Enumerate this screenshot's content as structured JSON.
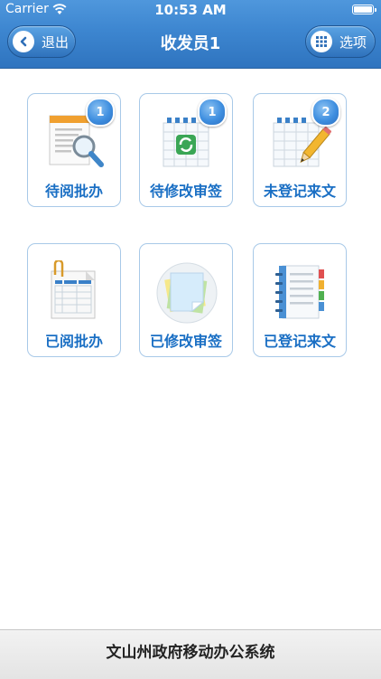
{
  "status_bar": {
    "carrier": "Carrier",
    "time": "10:53 AM"
  },
  "nav": {
    "title": "收发员1",
    "back_label": "退出",
    "options_label": "选项"
  },
  "tiles": [
    {
      "label": "待阅批办",
      "badge": "1",
      "icon": "document-search-icon"
    },
    {
      "label": "待修改审签",
      "badge": "1",
      "icon": "spreadsheet-refresh-icon"
    },
    {
      "label": "未登记来文",
      "badge": "2",
      "icon": "spreadsheet-pencil-icon"
    },
    {
      "label": "已阅批办",
      "badge": "",
      "icon": "clipped-table-icon"
    },
    {
      "label": "已修改审签",
      "badge": "",
      "icon": "sticky-notes-icon"
    },
    {
      "label": "已登记来文",
      "badge": "",
      "icon": "notebook-tabs-icon"
    }
  ],
  "footer": {
    "text": "文山州政府移动办公系统"
  },
  "colors": {
    "nav_blue": "#3d86d0",
    "tile_label": "#1a6fc4",
    "tile_border": "#a8c9e8",
    "badge_blue": "#3f8fe0"
  }
}
